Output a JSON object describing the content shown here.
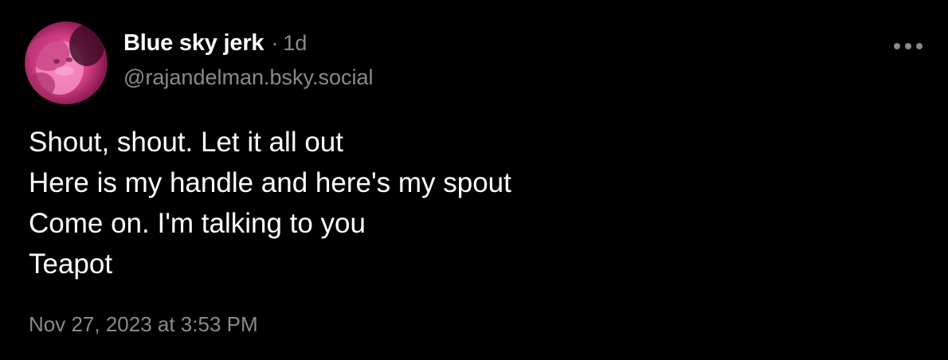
{
  "post": {
    "author": {
      "display_name": "Blue sky jerk",
      "separator": "·",
      "age": "1d",
      "handle": "@rajandelman.bsky.social",
      "avatar": "profile-photo"
    },
    "more_icon": "ellipsis-icon",
    "text_lines": [
      "Shout, shout. Let it all out",
      "Here is my handle and here's my spout",
      "Come on. I'm talking to you",
      "Teapot"
    ],
    "timestamp": "Nov 27, 2023 at 3:53 PM"
  },
  "colors": {
    "background": "#000000",
    "text_primary": "#ffffff",
    "text_secondary": "#8a8a8e",
    "avatar_tint": "#e0448f"
  }
}
